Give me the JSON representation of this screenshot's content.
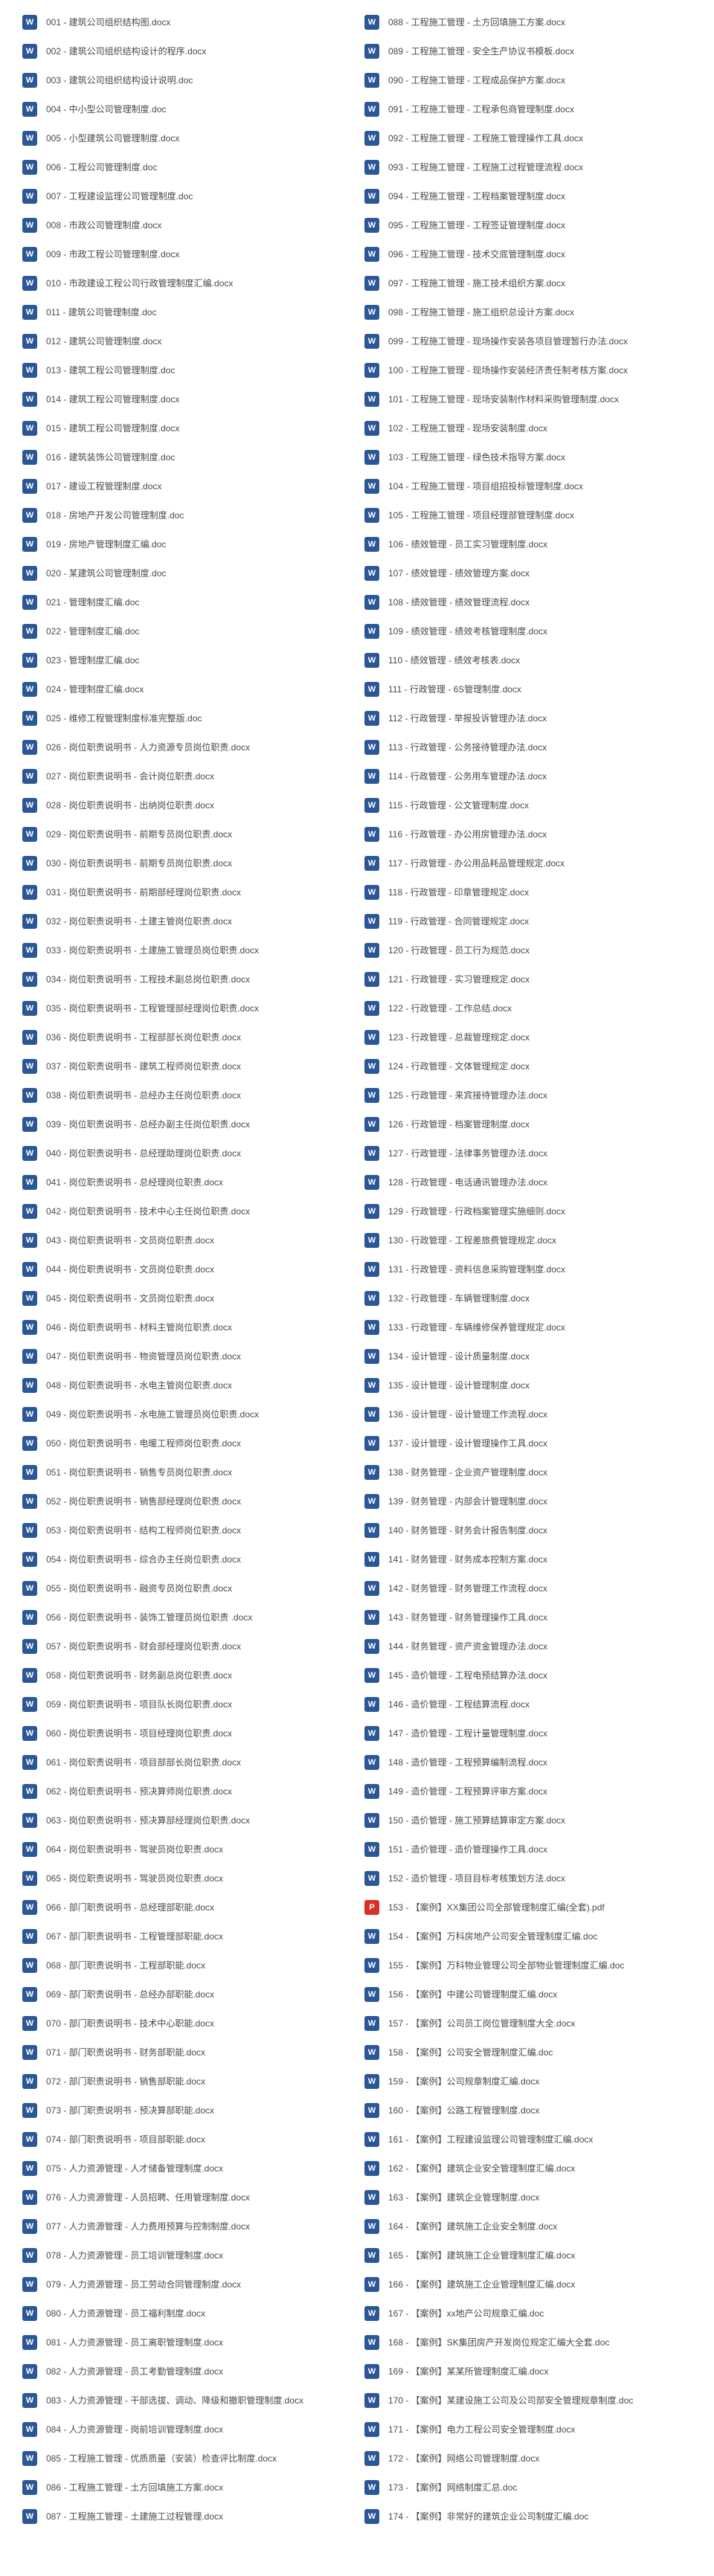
{
  "left_column": [
    {
      "id": "001",
      "name": "001 - 建筑公司组织结构图.docx",
      "type": "word"
    },
    {
      "id": "002",
      "name": "002 - 建筑公司组织结构设计的程序.docx",
      "type": "word"
    },
    {
      "id": "003",
      "name": "003 - 建筑公司组织结构设计说明.doc",
      "type": "word"
    },
    {
      "id": "004",
      "name": "004 - 中小型公司管理制度.doc",
      "type": "word"
    },
    {
      "id": "005",
      "name": "005 - 小型建筑公司管理制度.docx",
      "type": "word"
    },
    {
      "id": "006",
      "name": "006 - 工程公司管理制度.doc",
      "type": "word"
    },
    {
      "id": "007",
      "name": "007 - 工程建设监理公司管理制度.doc",
      "type": "word"
    },
    {
      "id": "008",
      "name": "008 - 市政公司管理制度.docx",
      "type": "word"
    },
    {
      "id": "009",
      "name": "009 - 市政工程公司管理制度.docx",
      "type": "word"
    },
    {
      "id": "010",
      "name": "010 - 市政建设工程公司行政管理制度汇编.docx",
      "type": "word"
    },
    {
      "id": "011",
      "name": "011 - 建筑公司管理制度.doc",
      "type": "word"
    },
    {
      "id": "012",
      "name": "012 - 建筑公司管理制度.docx",
      "type": "word"
    },
    {
      "id": "013",
      "name": "013 - 建筑工程公司管理制度.doc",
      "type": "word"
    },
    {
      "id": "014",
      "name": "014 - 建筑工程公司管理制度.docx",
      "type": "word"
    },
    {
      "id": "015",
      "name": "015 - 建筑工程公司管理制度.docx",
      "type": "word"
    },
    {
      "id": "016",
      "name": "016 - 建筑装饰公司管理制度.doc",
      "type": "word"
    },
    {
      "id": "017",
      "name": "017 - 建设工程管理制度.docx",
      "type": "word"
    },
    {
      "id": "018",
      "name": "018 - 房地产开发公司管理制度.doc",
      "type": "word"
    },
    {
      "id": "019",
      "name": "019 - 房地产管理制度汇编.doc",
      "type": "word"
    },
    {
      "id": "020",
      "name": "020 - 某建筑公司管理制度.doc",
      "type": "word"
    },
    {
      "id": "021",
      "name": "021 - 管理制度汇编.doc",
      "type": "word"
    },
    {
      "id": "022",
      "name": "022 - 管理制度汇编.doc",
      "type": "word"
    },
    {
      "id": "023",
      "name": "023 - 管理制度汇编.doc",
      "type": "word"
    },
    {
      "id": "024",
      "name": "024 - 管理制度汇编.docx",
      "type": "word"
    },
    {
      "id": "025",
      "name": "025 - 维修工程管理制度标准完整版.doc",
      "type": "word"
    },
    {
      "id": "026",
      "name": "026 - 岗位职责说明书 - 人力资源专员岗位职责.docx",
      "type": "word"
    },
    {
      "id": "027",
      "name": "027 - 岗位职责说明书 - 会计岗位职责.docx",
      "type": "word"
    },
    {
      "id": "028",
      "name": "028 - 岗位职责说明书 - 出纳岗位职责.docx",
      "type": "word"
    },
    {
      "id": "029",
      "name": "029 - 岗位职责说明书 - 前期专员岗位职责.docx",
      "type": "word"
    },
    {
      "id": "030",
      "name": "030 - 岗位职责说明书 - 前期专员岗位职责.docx",
      "type": "word"
    },
    {
      "id": "031",
      "name": "031 - 岗位职责说明书 - 前期部经理岗位职责.docx",
      "type": "word"
    },
    {
      "id": "032",
      "name": "032 - 岗位职责说明书 - 土建主管岗位职责.docx",
      "type": "word"
    },
    {
      "id": "033",
      "name": "033 - 岗位职责说明书 - 土建施工管理员岗位职责.docx",
      "type": "word"
    },
    {
      "id": "034",
      "name": "034 - 岗位职责说明书 - 工程技术副总岗位职责.docx",
      "type": "word"
    },
    {
      "id": "035",
      "name": "035 - 岗位职责说明书 - 工程管理部经理岗位职责.docx",
      "type": "word"
    },
    {
      "id": "036",
      "name": "036 - 岗位职责说明书 - 工程部部长岗位职责.docx",
      "type": "word"
    },
    {
      "id": "037",
      "name": "037 - 岗位职责说明书 - 建筑工程师岗位职责.docx",
      "type": "word"
    },
    {
      "id": "038",
      "name": "038 - 岗位职责说明书 - 总经办主任岗位职责.docx",
      "type": "word"
    },
    {
      "id": "039",
      "name": "039 - 岗位职责说明书 - 总经办副主任岗位职责.docx",
      "type": "word"
    },
    {
      "id": "040",
      "name": "040 - 岗位职责说明书 - 总经理助理岗位职责.docx",
      "type": "word"
    },
    {
      "id": "041",
      "name": "041 - 岗位职责说明书 - 总经理岗位职责.docx",
      "type": "word"
    },
    {
      "id": "042",
      "name": "042 - 岗位职责说明书 - 技术中心主任岗位职责.docx",
      "type": "word"
    },
    {
      "id": "043",
      "name": "043 - 岗位职责说明书 - 文员岗位职责.docx",
      "type": "word"
    },
    {
      "id": "044",
      "name": "044 - 岗位职责说明书 - 文员岗位职责.docx",
      "type": "word"
    },
    {
      "id": "045",
      "name": "045 - 岗位职责说明书 - 文员岗位职责.docx",
      "type": "word"
    },
    {
      "id": "046",
      "name": "046 - 岗位职责说明书 - 材料主管岗位职责.docx",
      "type": "word"
    },
    {
      "id": "047",
      "name": "047 - 岗位职责说明书 - 物资管理员岗位职责.docx",
      "type": "word"
    },
    {
      "id": "048",
      "name": "048 - 岗位职责说明书 - 水电主管岗位职责.docx",
      "type": "word"
    },
    {
      "id": "049",
      "name": "049 - 岗位职责说明书 - 水电施工管理员岗位职责.docx",
      "type": "word"
    },
    {
      "id": "050",
      "name": "050 - 岗位职责说明书 - 电暖工程师岗位职责.docx",
      "type": "word"
    },
    {
      "id": "051",
      "name": "051 - 岗位职责说明书 - 销售专员岗位职责.docx",
      "type": "word"
    },
    {
      "id": "052",
      "name": "052 - 岗位职责说明书 - 销售部经理岗位职责.docx",
      "type": "word"
    },
    {
      "id": "053",
      "name": "053 - 岗位职责说明书 - 结构工程师岗位职责.docx",
      "type": "word"
    },
    {
      "id": "054",
      "name": "054 - 岗位职责说明书 - 综合办主任岗位职责.docx",
      "type": "word"
    },
    {
      "id": "055",
      "name": "055 - 岗位职责说明书 - 融资专员岗位职责.docx",
      "type": "word"
    },
    {
      "id": "056",
      "name": "056 - 岗位职责说明书 - 装饰工管理员岗位职责 .docx",
      "type": "word"
    },
    {
      "id": "057",
      "name": "057 - 岗位职责说明书 - 财会部经理岗位职责.docx",
      "type": "word"
    },
    {
      "id": "058",
      "name": "058 - 岗位职责说明书 - 财务副总岗位职责.docx",
      "type": "word"
    },
    {
      "id": "059",
      "name": "059 - 岗位职责说明书 - 项目队长岗位职责.docx",
      "type": "word"
    },
    {
      "id": "060",
      "name": "060 - 岗位职责说明书 - 项目经理岗位职责.docx",
      "type": "word"
    },
    {
      "id": "061",
      "name": "061 - 岗位职责说明书 - 项目部部长岗位职责.docx",
      "type": "word"
    },
    {
      "id": "062",
      "name": "062 - 岗位职责说明书 - 预决算师岗位职责.docx",
      "type": "word"
    },
    {
      "id": "063",
      "name": "063 - 岗位职责说明书 - 预决算部经理岗位职责.docx",
      "type": "word"
    },
    {
      "id": "064",
      "name": "064 - 岗位职责说明书 - 驾驶员岗位职责.docx",
      "type": "word"
    },
    {
      "id": "065",
      "name": "065 - 岗位职责说明书 - 驾驶员岗位职责.docx",
      "type": "word"
    },
    {
      "id": "066",
      "name": "066 - 部门职责说明书 - 总经理部职能.docx",
      "type": "word"
    },
    {
      "id": "067",
      "name": "067 - 部门职责说明书 - 工程管理部职能.docx",
      "type": "word"
    },
    {
      "id": "068",
      "name": "068 - 部门职责说明书 - 工程部职能.docx",
      "type": "word"
    },
    {
      "id": "069",
      "name": "069 - 部门职责说明书 - 总经办部职能.docx",
      "type": "word"
    },
    {
      "id": "070",
      "name": "070 - 部门职责说明书 - 技术中心职能.docx",
      "type": "word"
    },
    {
      "id": "071",
      "name": "071 - 部门职责说明书 - 财务部职能.docx",
      "type": "word"
    },
    {
      "id": "072",
      "name": "072 - 部门职责说明书 - 销售部职能.docx",
      "type": "word"
    },
    {
      "id": "073",
      "name": "073 - 部门职责说明书 - 预决算部职能.docx",
      "type": "word"
    },
    {
      "id": "074",
      "name": "074 - 部门职责说明书 - 项目部职能.docx",
      "type": "word"
    },
    {
      "id": "075",
      "name": "075 - 人力资源管理 - 人才储备管理制度.docx",
      "type": "word"
    },
    {
      "id": "076",
      "name": "076 - 人力资源管理 - 人员招聘、任用管理制度.docx",
      "type": "word"
    },
    {
      "id": "077",
      "name": "077 - 人力资源管理 - 人力费用预算与控制制度.docx",
      "type": "word"
    },
    {
      "id": "078",
      "name": "078 - 人力资源管理 - 员工培训管理制度.docx",
      "type": "word"
    },
    {
      "id": "079",
      "name": "079 - 人力资源管理 - 员工劳动合同管理制度.docx",
      "type": "word"
    },
    {
      "id": "080",
      "name": "080 - 人力资源管理 - 员工福利制度.docx",
      "type": "word"
    },
    {
      "id": "081",
      "name": "081 - 人力资源管理 - 员工离职管理制度.docx",
      "type": "word"
    },
    {
      "id": "082",
      "name": "082 - 人力资源管理 - 员工考勤管理制度.docx",
      "type": "word"
    },
    {
      "id": "083",
      "name": "083 - 人力资源管理 - 干部选拔、调动、降级和撤职管理制度.docx",
      "type": "word"
    },
    {
      "id": "084",
      "name": "084 - 人力资源管理 - 岗前培训管理制度.docx",
      "type": "word"
    },
    {
      "id": "085",
      "name": "085 - 工程施工管理 - 优质质量（安装）检查评比制度.docx",
      "type": "word"
    },
    {
      "id": "086",
      "name": "086 - 工程施工管理 - 土方回填施工方案.docx",
      "type": "word"
    },
    {
      "id": "087",
      "name": "087 - 工程施工管理 - 土建施工过程管理.docx",
      "type": "word"
    }
  ],
  "right_column": [
    {
      "id": "088",
      "name": "088 - 工程施工管理 - 土方回填施工方案.docx",
      "type": "word"
    },
    {
      "id": "089",
      "name": "089 - 工程施工管理 - 安全生产协议书模板.docx",
      "type": "word"
    },
    {
      "id": "090",
      "name": "090 - 工程施工管理 - 工程成品保护方案.docx",
      "type": "word"
    },
    {
      "id": "091",
      "name": "091 - 工程施工管理 - 工程承包商管理制度.docx",
      "type": "word"
    },
    {
      "id": "092",
      "name": "092 - 工程施工管理 - 工程施工管理操作工具.docx",
      "type": "word"
    },
    {
      "id": "093",
      "name": "093 - 工程施工管理 - 工程施工过程管理流程.docx",
      "type": "word"
    },
    {
      "id": "094",
      "name": "094 - 工程施工管理 - 工程档案管理制度.docx",
      "type": "word"
    },
    {
      "id": "095",
      "name": "095 - 工程施工管理 - 工程签证管理制度.docx",
      "type": "word"
    },
    {
      "id": "096",
      "name": "096 - 工程施工管理 - 技术交底管理制度.docx",
      "type": "word"
    },
    {
      "id": "097",
      "name": "097 - 工程施工管理 - 施工技术组织方案.docx",
      "type": "word"
    },
    {
      "id": "098",
      "name": "098 - 工程施工管理 - 施工组织总设计方案.docx",
      "type": "word"
    },
    {
      "id": "099",
      "name": "099 - 工程施工管理 - 现场操作安装各项目管理暂行办法.docx",
      "type": "word"
    },
    {
      "id": "100",
      "name": "100 - 工程施工管理 - 现场操作安装经济责任制考核方案.docx",
      "type": "word"
    },
    {
      "id": "101",
      "name": "101 - 工程施工管理 - 现场安装制作材料采购管理制度.docx",
      "type": "word"
    },
    {
      "id": "102",
      "name": "102 - 工程施工管理 - 现场安装制度.docx",
      "type": "word"
    },
    {
      "id": "103",
      "name": "103 - 工程施工管理 - 绿色技术指导方案.docx",
      "type": "word"
    },
    {
      "id": "104",
      "name": "104 - 工程施工管理 - 项目组招投标管理制度.docx",
      "type": "word"
    },
    {
      "id": "105",
      "name": "105 - 工程施工管理 - 项目经理部管理制度.docx",
      "type": "word"
    },
    {
      "id": "106",
      "name": "106 - 绩效管理 - 员工实习管理制度.docx",
      "type": "word"
    },
    {
      "id": "107",
      "name": "107 - 绩效管理 - 绩效管理方案.docx",
      "type": "word"
    },
    {
      "id": "108",
      "name": "108 - 绩效管理 - 绩效管理流程.docx",
      "type": "word"
    },
    {
      "id": "109",
      "name": "109 - 绩效管理 - 绩效考核管理制度.docx",
      "type": "word"
    },
    {
      "id": "110",
      "name": "110 - 绩效管理 - 绩效考核表.docx",
      "type": "word"
    },
    {
      "id": "111",
      "name": "111 - 行政管理 - 6S管理制度.docx",
      "type": "word"
    },
    {
      "id": "112",
      "name": "112 - 行政管理 - 举报投诉管理办法.docx",
      "type": "word"
    },
    {
      "id": "113",
      "name": "113 - 行政管理 - 公务接待管理办法.docx",
      "type": "word"
    },
    {
      "id": "114",
      "name": "114 - 行政管理 - 公务用车管理办法.docx",
      "type": "word"
    },
    {
      "id": "115",
      "name": "115 - 行政管理 - 公文管理制度.docx",
      "type": "word"
    },
    {
      "id": "116",
      "name": "116 - 行政管理 - 办公用房管理办法.docx",
      "type": "word"
    },
    {
      "id": "117",
      "name": "117 - 行政管理 - 办公用品耗品管理规定.docx",
      "type": "word"
    },
    {
      "id": "118",
      "name": "118 - 行政管理 - 印章管理规定.docx",
      "type": "word"
    },
    {
      "id": "119",
      "name": "119 - 行政管理 - 合同管理规定.docx",
      "type": "word"
    },
    {
      "id": "120",
      "name": "120 - 行政管理 - 员工行为规范.docx",
      "type": "word"
    },
    {
      "id": "121",
      "name": "121 - 行政管理 - 实习管理规定.docx",
      "type": "word"
    },
    {
      "id": "122",
      "name": "122 - 行政管理 - 工作总结.docx",
      "type": "word"
    },
    {
      "id": "123",
      "name": "123 - 行政管理 - 总裁管理规定.docx",
      "type": "word"
    },
    {
      "id": "124",
      "name": "124 - 行政管理 - 文体管理规定.docx",
      "type": "word"
    },
    {
      "id": "125",
      "name": "125 - 行政管理 - 来宾接待管理办法.docx",
      "type": "word"
    },
    {
      "id": "126",
      "name": "126 - 行政管理 - 档案管理制度.docx",
      "type": "word"
    },
    {
      "id": "127",
      "name": "127 - 行政管理 - 法律事务管理办法.docx",
      "type": "word"
    },
    {
      "id": "128",
      "name": "128 - 行政管理 - 电话通讯管理办法.docx",
      "type": "word"
    },
    {
      "id": "129",
      "name": "129 - 行政管理 - 行政档案管理实施细则.docx",
      "type": "word"
    },
    {
      "id": "130",
      "name": "130 - 行政管理 - 工程差旅费管理规定.docx",
      "type": "word"
    },
    {
      "id": "131",
      "name": "131 - 行政管理 - 资料信息采购管理制度.docx",
      "type": "word"
    },
    {
      "id": "132",
      "name": "132 - 行政管理 - 车辆管理制度.docx",
      "type": "word"
    },
    {
      "id": "133",
      "name": "133 - 行政管理 - 车辆维修保养管理规定.docx",
      "type": "word"
    },
    {
      "id": "134",
      "name": "134 - 设计管理 - 设计质量制度.docx",
      "type": "word"
    },
    {
      "id": "135",
      "name": "135 - 设计管理 - 设计管理制度.docx",
      "type": "word"
    },
    {
      "id": "136",
      "name": "136 - 设计管理 - 设计管理工作流程.docx",
      "type": "word"
    },
    {
      "id": "137",
      "name": "137 - 设计管理 - 设计管理操作工具.docx",
      "type": "word"
    },
    {
      "id": "138",
      "name": "138 - 财务管理 - 企业资产管理制度.docx",
      "type": "word"
    },
    {
      "id": "139",
      "name": "139 - 财务管理 - 内部会计管理制度.docx",
      "type": "word"
    },
    {
      "id": "140",
      "name": "140 - 财务管理 - 财务会计报告制度.docx",
      "type": "word"
    },
    {
      "id": "141",
      "name": "141 - 财务管理 - 财务成本控制方案.docx",
      "type": "word"
    },
    {
      "id": "142",
      "name": "142 - 财务管理 - 财务管理工作流程.docx",
      "type": "word"
    },
    {
      "id": "143",
      "name": "143 - 财务管理 - 财务管理操作工具.docx",
      "type": "word"
    },
    {
      "id": "144",
      "name": "144 - 财务管理 - 资产资金管理办法.docx",
      "type": "word"
    },
    {
      "id": "145",
      "name": "145 - 造价管理 - 工程电预结算办法.docx",
      "type": "word"
    },
    {
      "id": "146",
      "name": "146 - 造价管理 - 工程结算流程.docx",
      "type": "word"
    },
    {
      "id": "147",
      "name": "147 - 造价管理 - 工程计量管理制度.docx",
      "type": "word"
    },
    {
      "id": "148",
      "name": "148 - 造价管理 - 工程预算编制流程.docx",
      "type": "word"
    },
    {
      "id": "149",
      "name": "149 - 造价管理 - 工程预算评审方案.docx",
      "type": "word"
    },
    {
      "id": "150",
      "name": "150 - 造价管理 - 施工预算结算审定方案.docx",
      "type": "word"
    },
    {
      "id": "151",
      "name": "151 - 造价管理 - 造价管理操作工具.docx",
      "type": "word"
    },
    {
      "id": "152",
      "name": "152 - 造价管理 - 项目目标考核策划方法.docx",
      "type": "word"
    },
    {
      "id": "153",
      "name": "153 - 【案例】XX集团公司全部管理制度汇编(全套).pdf",
      "type": "pdf"
    },
    {
      "id": "154",
      "name": "154 - 【案例】万科房地产公司安全管理制度汇编.doc",
      "type": "word"
    },
    {
      "id": "155",
      "name": "155 - 【案例】万科物业管理公司全部物业管理制度汇编.doc",
      "type": "word"
    },
    {
      "id": "156",
      "name": "156 - 【案例】中建公司管理制度汇编.docx",
      "type": "word"
    },
    {
      "id": "157",
      "name": "157 - 【案例】公司员工岗位管理制度大全.docx",
      "type": "word"
    },
    {
      "id": "158",
      "name": "158 - 【案例】公司安全管理制度汇编.doc",
      "type": "word"
    },
    {
      "id": "159",
      "name": "159 - 【案例】公司规章制度汇编.docx",
      "type": "word"
    },
    {
      "id": "160",
      "name": "160 - 【案例】公路工程管理制度.docx",
      "type": "word"
    },
    {
      "id": "161",
      "name": "161 - 【案例】工程建设监理公司管理制度汇编.docx",
      "type": "word"
    },
    {
      "id": "162",
      "name": "162 - 【案例】建筑企业安全管理制度汇编.docx",
      "type": "word"
    },
    {
      "id": "163",
      "name": "163 - 【案例】建筑企业管理制度.docx",
      "type": "word"
    },
    {
      "id": "164",
      "name": "164 - 【案例】建筑施工企业安全制度.docx",
      "type": "word"
    },
    {
      "id": "165",
      "name": "165 - 【案例】建筑施工企业管理制度汇编.docx",
      "type": "word"
    },
    {
      "id": "166",
      "name": "166 - 【案例】建筑施工企业管理制度汇编.docx",
      "type": "word"
    },
    {
      "id": "167",
      "name": "167 - 【案例】xx地产公司规章汇编.doc",
      "type": "word"
    },
    {
      "id": "168",
      "name": "168 - 【案例】SK集团房产开发岗位规定汇编大全套.doc",
      "type": "word"
    },
    {
      "id": "169",
      "name": "169 - 【案例】某某所管理制度汇编.docx",
      "type": "word"
    },
    {
      "id": "170",
      "name": "170 - 【案例】某建设施工公司及公司部安全管理规章制度.doc",
      "type": "word"
    },
    {
      "id": "171",
      "name": "171 - 【案例】电力工程公司安全管理制度.docx",
      "type": "word"
    },
    {
      "id": "172",
      "name": "172 - 【案例】网络公司管理制度.docx",
      "type": "word"
    },
    {
      "id": "173",
      "name": "173 - 【案例】网络制度汇总.doc",
      "type": "word"
    },
    {
      "id": "174",
      "name": "174 - 【案例】非常好的建筑企业公司制度汇编.doc",
      "type": "word"
    }
  ]
}
